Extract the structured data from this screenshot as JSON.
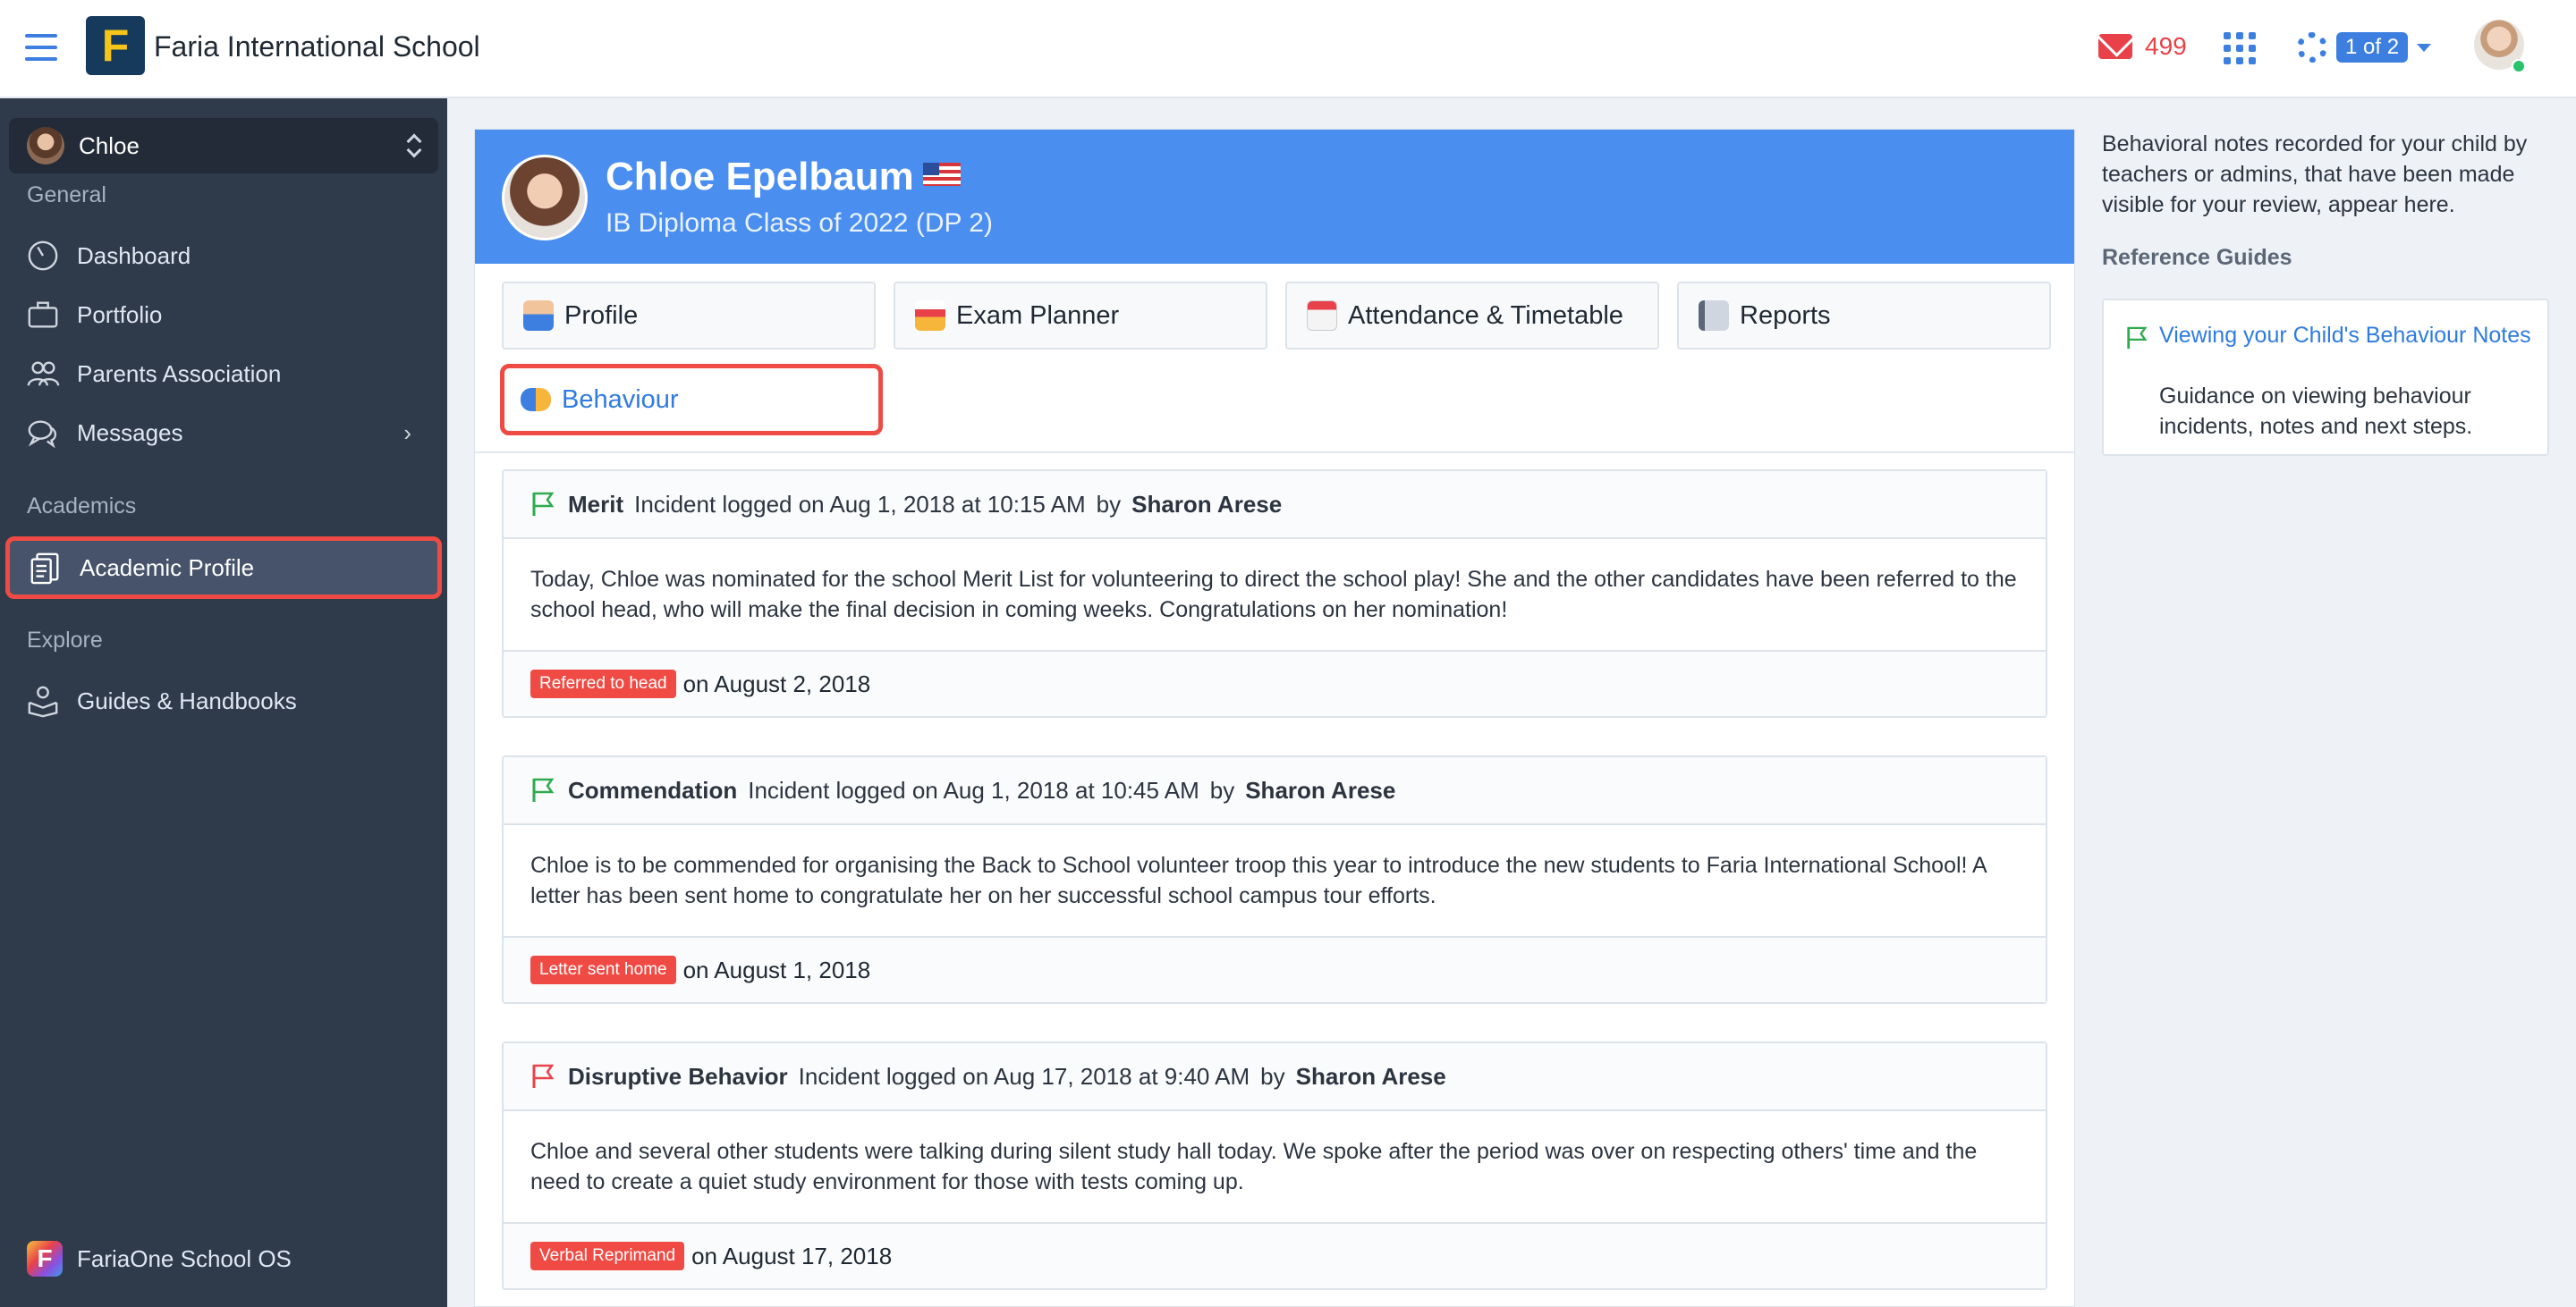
{
  "header": {
    "school_name": "Faria International School",
    "logo_letter": "F",
    "mail_count": "499",
    "help_badge": "1 of 2"
  },
  "sidebar": {
    "child_name": "Chloe",
    "sections": {
      "general": "General",
      "academics": "Academics",
      "explore": "Explore"
    },
    "items": {
      "dashboard": "Dashboard",
      "portfolio": "Portfolio",
      "parents_association": "Parents Association",
      "messages": "Messages",
      "academic_profile": "Academic Profile",
      "guides": "Guides & Handbooks"
    },
    "footer": "FariaOne School OS",
    "footer_logo_letter": "F"
  },
  "student": {
    "name": "Chloe Epelbaum",
    "class": "IB Diploma Class of 2022 (DP 2)"
  },
  "tabs": {
    "profile": "Profile",
    "exam_planner": "Exam Planner",
    "attendance": "Attendance & Timetable",
    "reports": "Reports",
    "behaviour": "Behaviour"
  },
  "incidents": [
    {
      "type": "Merit",
      "logged": "Incident logged on Aug 1, 2018 at 10:15 AM",
      "by": "by",
      "author": "Sharon Arese",
      "body": "Today, Chloe was nominated for the school Merit List for volunteering to direct the school play! She and the other candidates have been referred to the school head, who will make the final decision in coming weeks. Congratulations on her nomination!",
      "action": "Referred to head",
      "action_date": "on August 2, 2018",
      "flag_color": "#2eaa4f"
    },
    {
      "type": "Commendation",
      "logged": "Incident logged on Aug 1, 2018 at 10:45 AM",
      "by": "by",
      "author": "Sharon Arese",
      "body": "Chloe is to be commended for organising the Back to School volunteer troop this year to introduce the new students to Faria International School! A letter has been sent home to congratulate her on her successful school campus tour efforts.",
      "action": "Letter sent home",
      "action_date": "on August 1, 2018",
      "flag_color": "#2eaa4f"
    },
    {
      "type": "Disruptive Behavior",
      "logged": "Incident logged on Aug 17, 2018 at 9:40 AM",
      "by": "by",
      "author": "Sharon Arese",
      "body": "Chloe and several other students were talking during silent study hall today. We spoke after the period was over on respecting others' time and the need to create a quiet study environment for those with tests coming up.",
      "action": "Verbal Reprimand",
      "action_date": "on August 17, 2018",
      "flag_color": "#e8414a"
    }
  ],
  "right_panel": {
    "info": "Behavioral notes recorded for your child by teachers or admins, that have been made visible for your review, appear here.",
    "ref_title": "Reference Guides",
    "guide_link": "Viewing your Child's Behaviour Notes",
    "guide_desc": "Guidance on viewing behaviour incidents, notes and next steps."
  },
  "colors": {
    "accent": "#3d7fe0",
    "header_blue": "#4a8ef0",
    "sidebar_bg": "#2f3a4a",
    "highlight_red": "#ef4b44",
    "merit_green": "#2eaa4f"
  }
}
